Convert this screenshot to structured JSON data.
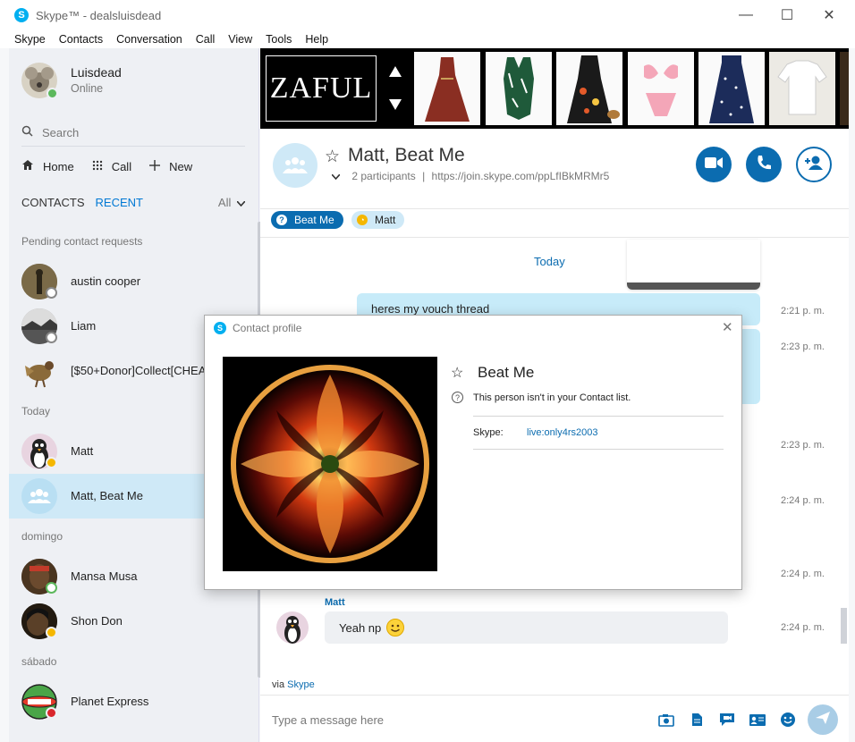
{
  "window": {
    "title": "Skype™ - dealsluisdead",
    "controls": {
      "minimize": "—",
      "maximize": "☐",
      "close": "✕"
    }
  },
  "menu": [
    "Skype",
    "Contacts",
    "Conversation",
    "Call",
    "View",
    "Tools",
    "Help"
  ],
  "profile": {
    "name": "Luisdead",
    "status": "Online"
  },
  "search": {
    "label": "Search"
  },
  "nav": {
    "home": "Home",
    "call": "Call",
    "new": "New"
  },
  "tabs": {
    "contacts": "CONTACTS",
    "recent": "RECENT",
    "filter": "All"
  },
  "sections": {
    "pending": "Pending contact requests",
    "today": "Today",
    "domingo": "domingo",
    "sabado": "sábado"
  },
  "contacts": {
    "austin": "austin cooper",
    "liam": "Liam",
    "donor": "[$50+Donor]Collect[CHEA",
    "matt": "Matt",
    "group": "Matt, Beat Me",
    "mansa": "Mansa Musa",
    "shon": "Shon Don",
    "planet": "Planet Express"
  },
  "ad": {
    "brand": "ZAFUL"
  },
  "conversation": {
    "title": "Matt, Beat Me",
    "participants": "2 participants",
    "separator": "|",
    "link": "https://join.skype.com/ppLfIBkMRMr5",
    "pills": [
      "Beat Me",
      "Matt"
    ],
    "date": "Today",
    "messages": {
      "vouch": "heres my vouch thread",
      "reply": "Yeah np"
    },
    "times": [
      "2:21 p. m.",
      "2:23 p. m.",
      "2:23 p. m.",
      "2:24 p. m.",
      "2:24 p. m.",
      "2:24 p. m."
    ],
    "sender": "Matt",
    "via_prefix": "via",
    "via_link": "Skype",
    "composer_placeholder": "Type a message here"
  },
  "dialog": {
    "title": "Contact profile",
    "name": "Beat Me",
    "note": "This person isn't in your Contact list.",
    "skype_label": "Skype:",
    "skype_value": "live:only4rs2003"
  },
  "colors": {
    "accent": "#0b6cb0",
    "selected": "#cfe9f7",
    "outgoing": "#c7ebf9"
  }
}
